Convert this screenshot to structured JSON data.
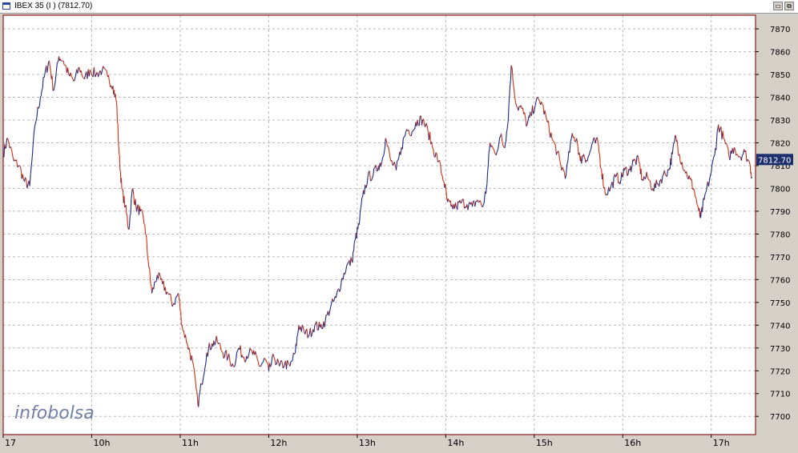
{
  "window": {
    "title": "IBEX 35 (I ) (7812.70)",
    "min_glyph": "▭",
    "restore_glyph": "⧉",
    "icon": "chart-window-icon"
  },
  "watermark": {
    "part1": "info",
    "part2": "bolsa"
  },
  "last_price_label": "7812.70",
  "colors": {
    "plot_bg": "#ffffff",
    "frame": "#8b1a1a",
    "grid": "#b8b8b8",
    "price_up": "#1a2a8a",
    "price_down": "#d23010",
    "label_box": "#1e2f6e",
    "watermark": "#5a6a9a"
  },
  "chart_data": {
    "type": "line",
    "title": "IBEX 35 (I ) (7812.70)",
    "xlabel": "",
    "ylabel": "",
    "ylim": [
      7692,
      7876
    ],
    "xlim": [
      0,
      8.5
    ],
    "y_ticks": [
      7700,
      7710,
      7720,
      7730,
      7740,
      7750,
      7760,
      7770,
      7780,
      7790,
      7800,
      7810,
      7820,
      7830,
      7840,
      7850,
      7860,
      7870
    ],
    "x_ticks": [
      {
        "x": 0.0,
        "label": "17"
      },
      {
        "x": 1.0,
        "label": "10h"
      },
      {
        "x": 2.0,
        "label": "11h"
      },
      {
        "x": 3.0,
        "label": "12h"
      },
      {
        "x": 4.0,
        "label": "13h"
      },
      {
        "x": 5.0,
        "label": "14h"
      },
      {
        "x": 6.0,
        "label": "15h"
      },
      {
        "x": 7.0,
        "label": "16h"
      },
      {
        "x": 8.0,
        "label": "17h"
      }
    ],
    "grid": true,
    "last_value": 7812.7,
    "series": [
      {
        "values": [
          [
            0.0,
            7815
          ],
          [
            0.05,
            7822
          ],
          [
            0.12,
            7812
          ],
          [
            0.18,
            7810
          ],
          [
            0.24,
            7803
          ],
          [
            0.3,
            7801
          ],
          [
            0.36,
            7828
          ],
          [
            0.42,
            7840
          ],
          [
            0.47,
            7850
          ],
          [
            0.52,
            7856
          ],
          [
            0.57,
            7843
          ],
          [
            0.63,
            7858
          ],
          [
            0.68,
            7856
          ],
          [
            0.74,
            7850
          ],
          [
            0.8,
            7847
          ],
          [
            0.86,
            7853
          ],
          [
            0.92,
            7848
          ],
          [
            0.98,
            7852
          ],
          [
            1.05,
            7850
          ],
          [
            1.12,
            7852
          ],
          [
            1.18,
            7849
          ],
          [
            1.24,
            7845
          ],
          [
            1.28,
            7838
          ],
          [
            1.31,
            7815
          ],
          [
            1.34,
            7800
          ],
          [
            1.38,
            7792
          ],
          [
            1.42,
            7782
          ],
          [
            1.46,
            7800
          ],
          [
            1.5,
            7792
          ],
          [
            1.55,
            7790
          ],
          [
            1.6,
            7784
          ],
          [
            1.64,
            7768
          ],
          [
            1.68,
            7754
          ],
          [
            1.74,
            7762
          ],
          [
            1.8,
            7758
          ],
          [
            1.86,
            7754
          ],
          [
            1.92,
            7749
          ],
          [
            1.98,
            7754
          ],
          [
            2.02,
            7740
          ],
          [
            2.08,
            7732
          ],
          [
            2.14,
            7724
          ],
          [
            2.2,
            7705
          ],
          [
            2.24,
            7714
          ],
          [
            2.3,
            7728
          ],
          [
            2.36,
            7732
          ],
          [
            2.42,
            7733
          ],
          [
            2.48,
            7728
          ],
          [
            2.54,
            7726
          ],
          [
            2.6,
            7722
          ],
          [
            2.66,
            7730
          ],
          [
            2.72,
            7726
          ],
          [
            2.78,
            7728
          ],
          [
            2.84,
            7727
          ],
          [
            2.9,
            7722
          ],
          [
            2.96,
            7725
          ],
          [
            3.0,
            7720
          ],
          [
            3.06,
            7726
          ],
          [
            3.12,
            7722
          ],
          [
            3.18,
            7723
          ],
          [
            3.24,
            7722
          ],
          [
            3.3,
            7728
          ],
          [
            3.34,
            7740
          ],
          [
            3.4,
            7737
          ],
          [
            3.46,
            7736
          ],
          [
            3.52,
            7740
          ],
          [
            3.58,
            7739
          ],
          [
            3.64,
            7742
          ],
          [
            3.7,
            7748
          ],
          [
            3.76,
            7752
          ],
          [
            3.82,
            7759
          ],
          [
            3.88,
            7766
          ],
          [
            3.94,
            7768
          ],
          [
            3.98,
            7778
          ],
          [
            4.02,
            7784
          ],
          [
            4.06,
            7796
          ],
          [
            4.12,
            7805
          ],
          [
            4.18,
            7806
          ],
          [
            4.24,
            7810
          ],
          [
            4.28,
            7812
          ],
          [
            4.32,
            7822
          ],
          [
            4.38,
            7812
          ],
          [
            4.44,
            7808
          ],
          [
            4.5,
            7818
          ],
          [
            4.56,
            7826
          ],
          [
            4.62,
            7825
          ],
          [
            4.68,
            7830
          ],
          [
            4.74,
            7830
          ],
          [
            4.8,
            7825
          ],
          [
            4.86,
            7817
          ],
          [
            4.92,
            7812
          ],
          [
            4.98,
            7803
          ],
          [
            5.02,
            7794
          ],
          [
            5.06,
            7792
          ],
          [
            5.12,
            7792
          ],
          [
            5.18,
            7794
          ],
          [
            5.24,
            7793
          ],
          [
            5.3,
            7792
          ],
          [
            5.36,
            7795
          ],
          [
            5.42,
            7792
          ],
          [
            5.46,
            7800
          ],
          [
            5.5,
            7820
          ],
          [
            5.56,
            7815
          ],
          [
            5.62,
            7823
          ],
          [
            5.66,
            7818
          ],
          [
            5.7,
            7828
          ],
          [
            5.74,
            7854
          ],
          [
            5.8,
            7836
          ],
          [
            5.86,
            7835
          ],
          [
            5.92,
            7828
          ],
          [
            5.96,
            7832
          ],
          [
            6.02,
            7838
          ],
          [
            6.08,
            7838
          ],
          [
            6.14,
            7830
          ],
          [
            6.2,
            7822
          ],
          [
            6.26,
            7816
          ],
          [
            6.3,
            7810
          ],
          [
            6.36,
            7806
          ],
          [
            6.42,
            7822
          ],
          [
            6.48,
            7822
          ],
          [
            6.52,
            7812
          ],
          [
            6.56,
            7815
          ],
          [
            6.6,
            7812
          ],
          [
            6.66,
            7820
          ],
          [
            6.72,
            7820
          ],
          [
            6.76,
            7808
          ],
          [
            6.8,
            7798
          ],
          [
            6.86,
            7800
          ],
          [
            6.92,
            7805
          ],
          [
            6.98,
            7804
          ],
          [
            7.02,
            7808
          ],
          [
            7.08,
            7808
          ],
          [
            7.12,
            7812
          ],
          [
            7.18,
            7812
          ],
          [
            7.22,
            7804
          ],
          [
            7.28,
            7805
          ],
          [
            7.34,
            7800
          ],
          [
            7.4,
            7802
          ],
          [
            7.46,
            7806
          ],
          [
            7.52,
            7808
          ],
          [
            7.56,
            7815
          ],
          [
            7.6,
            7823
          ],
          [
            7.64,
            7815
          ],
          [
            7.7,
            7808
          ],
          [
            7.76,
            7804
          ],
          [
            7.8,
            7800
          ],
          [
            7.86,
            7790
          ],
          [
            7.88,
            7787
          ],
          [
            7.92,
            7795
          ],
          [
            7.98,
            7804
          ],
          [
            8.04,
            7815
          ],
          [
            8.08,
            7828
          ],
          [
            8.14,
            7822
          ],
          [
            8.2,
            7814
          ],
          [
            8.26,
            7818
          ],
          [
            8.32,
            7814
          ],
          [
            8.38,
            7816
          ],
          [
            8.44,
            7810
          ],
          [
            8.46,
            7805
          ]
        ]
      }
    ]
  }
}
